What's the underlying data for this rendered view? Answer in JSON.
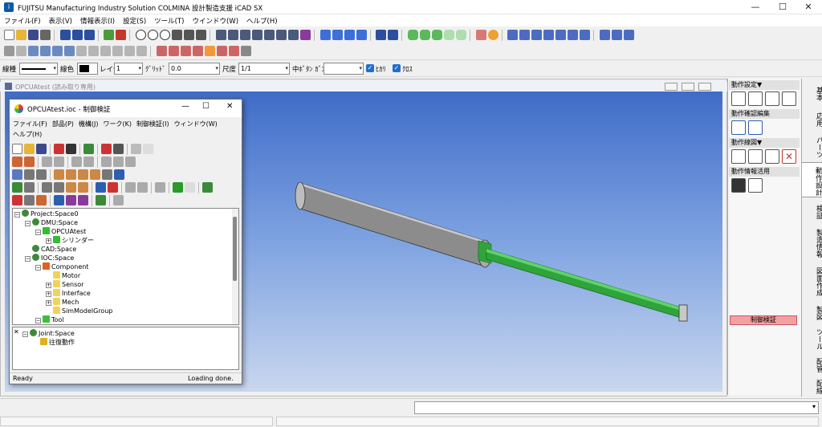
{
  "app": {
    "title": "FUJITSU Manufacturing Industry Solution COLMINA 設計製造支援 iCAD SX",
    "icon": "icad-logo-icon",
    "min": "—",
    "max": "☐",
    "close": "✕"
  },
  "menu": [
    "ファイル(F)",
    "表示(V)",
    "情報表示(I)",
    "設定(S)",
    "ツール(T)",
    "ウインドウ(W)",
    "ヘルプ(H)"
  ],
  "props": {
    "line_type_label": "線種",
    "line_color_label": "線色",
    "layer_label": "レイヤ",
    "layer_value": "1",
    "grid_label": "ｸﾞﾘｯﾄﾞ",
    "grid_value": "0.0",
    "scale_label": "尺度",
    "scale_value": "1/1",
    "middle_button_label": "中ﾎﾞﾀﾝ ｶﾞﾝｸﾞ",
    "hikari_label": "ﾋｶﾘ",
    "cross_label": "ｸﾛｽ",
    "check_mark": "✓",
    "arrow": "▾"
  },
  "viewport": {
    "title": "OPCUAtest (読み取り専用)",
    "model_color": "#2fa43a",
    "body_color": "#9a9a9a"
  },
  "right_panel": {
    "sections": [
      "動作設定▼",
      "動作確認編集",
      "動作線図▼",
      "動作情報活用"
    ],
    "button": "制御検証",
    "tabs": [
      "基本",
      "応用",
      "パーツ",
      "動作設計",
      "検証",
      "製造情報",
      "図面作成",
      "製図",
      "ツール",
      "配管",
      "配線"
    ]
  },
  "dialog": {
    "title": "OPCUAtest.ioc - 制御検証",
    "menu": [
      "ファイル(F)",
      "部品(P)",
      "機構(J)",
      "ワーク(K)",
      "制御検証(I)",
      "ウィンドウ(W)",
      "ヘルプ(H)"
    ],
    "status_left": "Ready",
    "status_right": "Loading done.",
    "min": "—",
    "max": "☐",
    "close": "✕"
  },
  "tree": [
    {
      "label": "Project:Space0",
      "depth": 0,
      "pm": "-",
      "icon": "globe"
    },
    {
      "label": "DMU:Space",
      "depth": 1,
      "pm": "-",
      "icon": "globe"
    },
    {
      "label": "OPCUAtest",
      "depth": 2,
      "pm": "-",
      "icon": "green"
    },
    {
      "label": "シリンダー",
      "depth": 3,
      "pm": "+",
      "icon": "green"
    },
    {
      "label": "CAD:Space",
      "depth": 1,
      "pm": "",
      "icon": "globe"
    },
    {
      "label": "IOC:Space",
      "depth": 1,
      "pm": "-",
      "icon": "globe"
    },
    {
      "label": "Component",
      "depth": 2,
      "pm": "-",
      "icon": "orange"
    },
    {
      "label": "Motor",
      "depth": 3,
      "pm": "",
      "icon": "folder"
    },
    {
      "label": "Sensor",
      "depth": 3,
      "pm": "+",
      "icon": "folder"
    },
    {
      "label": "Interface",
      "depth": 3,
      "pm": "+",
      "icon": "folder"
    },
    {
      "label": "Mech",
      "depth": 3,
      "pm": "+",
      "icon": "folder"
    },
    {
      "label": "SimModelGroup",
      "depth": 3,
      "pm": "",
      "icon": "folder"
    },
    {
      "label": "Tool",
      "depth": 2,
      "pm": "-",
      "icon": "greenbox"
    },
    {
      "label": "位置決めコントローラ",
      "depth": 3,
      "pm": "",
      "icon": "gear"
    }
  ],
  "tree2": [
    {
      "label": "Joint:Space",
      "depth": 0,
      "pm": "-",
      "icon": "globe"
    },
    {
      "label": "往復動作",
      "depth": 1,
      "pm": "",
      "icon": "yellowbox"
    }
  ]
}
